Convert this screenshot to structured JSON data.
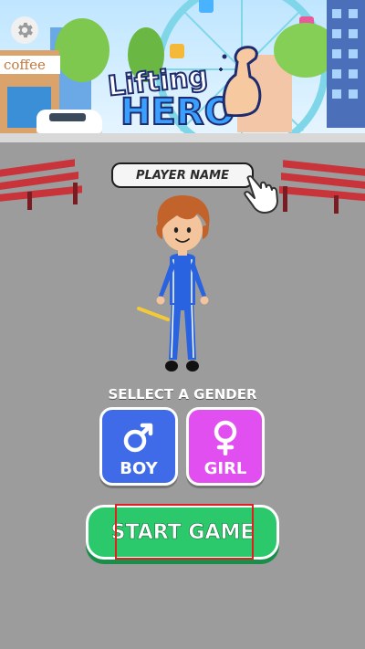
{
  "logo": {
    "line1": "Lifting",
    "line2": "HERO"
  },
  "shop_sign": "coffee",
  "player_name": {
    "placeholder": "PLAYER NAME"
  },
  "gender": {
    "title": "SELLECT A GENDER",
    "boy_label": "BOY",
    "girl_label": "GIRL",
    "boy_symbol": "♂",
    "girl_symbol": "♀"
  },
  "start_button": {
    "label": "START GAME"
  },
  "colors": {
    "boy": "#3f6be8",
    "girl": "#e24ff0",
    "start": "#2bc96b",
    "highlight": "#e02020"
  },
  "icons": [
    "gear-icon",
    "flexed-arm-icon",
    "tap-hand-icon",
    "male-icon",
    "female-icon"
  ]
}
